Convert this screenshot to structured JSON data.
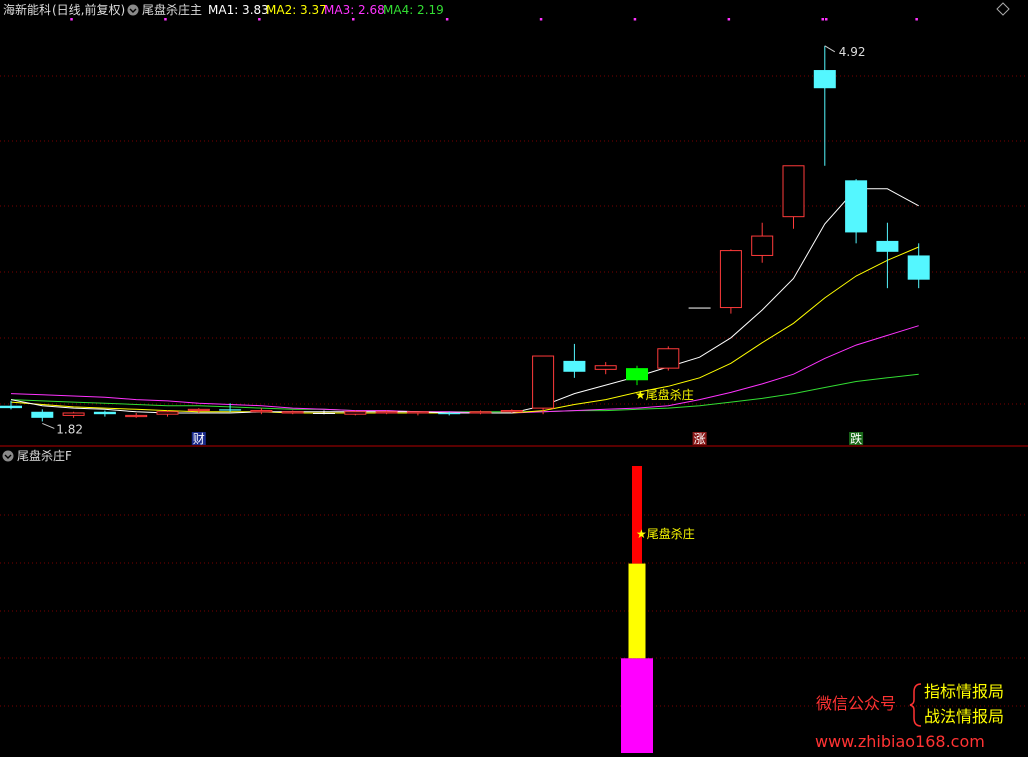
{
  "header": {
    "stock": "海新能科",
    "period": "(日线,前复权)",
    "indicator": "尾盘杀庄主",
    "ma_labels": [
      {
        "label": "MA1: 3.83",
        "color": "#ffffff"
      },
      {
        "label": "MA2: 3.37",
        "color": "#ffff00"
      },
      {
        "label": "MA3: 2.68",
        "color": "#ff33ff"
      },
      {
        "label": "MA4: 2.19",
        "color": "#33dd33"
      }
    ]
  },
  "sub_header": {
    "title": "尾盘杀庄F"
  },
  "annotations": {
    "high_label": "4.92",
    "low_label": "1.82",
    "signal_main": "★尾盘杀庄",
    "signal_sub": "★尾盘杀庄",
    "markers": [
      "财",
      "涨",
      "跌"
    ]
  },
  "watermark": {
    "wechat": "微信公众号",
    "line1": "指标情报局",
    "line2": "战法情报局",
    "url": "www.zhibiao168.com"
  },
  "colors": {
    "up": "#ff3b3b",
    "down": "#54f7ff",
    "flat": "#ffffff",
    "signal_candle": "#00ff00",
    "grid": "#7a0000",
    "divider": "#b40000",
    "ma1": "#ffffff",
    "ma2": "#ffff00",
    "ma3": "#ff33ff",
    "ma4": "#33dd33",
    "bar_red": "#ff0000",
    "bar_yellow": "#ffff00",
    "bar_magenta": "#ff00ff"
  },
  "chart_data": [
    {
      "type": "candlestick",
      "title": "尾盘杀庄主",
      "ylim": [
        1.7,
        5.1
      ],
      "candles": [
        {
          "o": 1.95,
          "h": 1.99,
          "l": 1.92,
          "c": 1.93
        },
        {
          "o": 1.9,
          "h": 1.92,
          "l": 1.82,
          "c": 1.85
        },
        {
          "o": 1.87,
          "h": 1.9,
          "l": 1.85,
          "c": 1.89
        },
        {
          "o": 1.9,
          "h": 1.91,
          "l": 1.86,
          "c": 1.88
        },
        {
          "o": 1.86,
          "h": 1.89,
          "l": 1.85,
          "c": 1.87
        },
        {
          "o": 1.88,
          "h": 1.91,
          "l": 1.86,
          "c": 1.9
        },
        {
          "o": 1.91,
          "h": 1.93,
          "l": 1.89,
          "c": 1.92
        },
        {
          "o": 1.92,
          "h": 1.97,
          "l": 1.9,
          "c": 1.91
        },
        {
          "o": 1.9,
          "h": 1.93,
          "l": 1.88,
          "c": 1.91
        },
        {
          "o": 1.89,
          "h": 1.91,
          "l": 1.88,
          "c": 1.9
        },
        {
          "o": 1.89,
          "h": 1.91,
          "l": 1.88,
          "c": 1.89
        },
        {
          "o": 1.88,
          "h": 1.91,
          "l": 1.87,
          "c": 1.9
        },
        {
          "o": 1.89,
          "h": 1.91,
          "l": 1.88,
          "c": 1.9
        },
        {
          "o": 1.89,
          "h": 1.9,
          "l": 1.87,
          "c": 1.9
        },
        {
          "o": 1.89,
          "h": 1.9,
          "l": 1.87,
          "c": 1.88
        },
        {
          "o": 1.89,
          "h": 1.91,
          "l": 1.88,
          "c": 1.9
        },
        {
          "o": 1.9,
          "h": 1.92,
          "l": 1.89,
          "c": 1.91
        },
        {
          "o": 1.93,
          "h": 1.95,
          "l": 1.88,
          "c": 2.36
        },
        {
          "o": 2.32,
          "h": 2.46,
          "l": 2.18,
          "c": 2.23
        },
        {
          "o": 2.25,
          "h": 2.31,
          "l": 2.21,
          "c": 2.28
        },
        {
          "o": 2.26,
          "h": 2.28,
          "l": 2.12,
          "c": 2.16
        },
        {
          "o": 2.26,
          "h": 2.44,
          "l": 2.24,
          "c": 2.42
        },
        {
          "o": 2.76,
          "h": 2.76,
          "l": 2.76,
          "c": 2.76
        },
        {
          "o": 2.76,
          "h": 3.24,
          "l": 2.71,
          "c": 3.23
        },
        {
          "o": 3.19,
          "h": 3.46,
          "l": 3.13,
          "c": 3.35
        },
        {
          "o": 3.51,
          "h": 3.93,
          "l": 3.41,
          "c": 3.93
        },
        {
          "o": 4.72,
          "h": 4.92,
          "l": 3.93,
          "c": 4.57
        },
        {
          "o": 3.81,
          "h": 3.82,
          "l": 3.29,
          "c": 3.38
        },
        {
          "o": 3.31,
          "h": 3.46,
          "l": 2.92,
          "c": 3.22
        },
        {
          "o": 3.19,
          "h": 3.29,
          "l": 2.92,
          "c": 2.99
        }
      ],
      "ma1": [
        2.0,
        1.95,
        1.93,
        1.92,
        1.9,
        1.89,
        1.89,
        1.89,
        1.9,
        1.9,
        1.9,
        1.9,
        1.9,
        1.9,
        1.89,
        1.89,
        1.89,
        1.95,
        2.05,
        2.12,
        2.19,
        2.27,
        2.35,
        2.51,
        2.74,
        3.0,
        3.45,
        3.74,
        3.74,
        3.6
      ],
      "ma2": [
        1.98,
        1.96,
        1.94,
        1.93,
        1.92,
        1.91,
        1.9,
        1.9,
        1.9,
        1.89,
        1.89,
        1.89,
        1.89,
        1.89,
        1.89,
        1.89,
        1.89,
        1.91,
        1.96,
        2.0,
        2.06,
        2.11,
        2.18,
        2.3,
        2.47,
        2.63,
        2.84,
        3.02,
        3.15,
        3.26
      ],
      "ma3": [
        2.05,
        2.04,
        2.03,
        2.02,
        2.0,
        1.99,
        1.97,
        1.96,
        1.95,
        1.93,
        1.92,
        1.91,
        1.91,
        1.9,
        1.9,
        1.89,
        1.89,
        1.9,
        1.91,
        1.92,
        1.93,
        1.95,
        2.0,
        2.06,
        2.13,
        2.21,
        2.34,
        2.45,
        2.53,
        2.61
      ],
      "ma4": [
        2.0,
        1.99,
        1.98,
        1.97,
        1.96,
        1.95,
        1.95,
        1.94,
        1.93,
        1.92,
        1.92,
        1.91,
        1.91,
        1.9,
        1.9,
        1.9,
        1.9,
        1.9,
        1.91,
        1.91,
        1.92,
        1.93,
        1.95,
        1.98,
        2.01,
        2.05,
        2.1,
        2.15,
        2.18,
        2.21
      ],
      "signal_index": 20,
      "high_index": 26,
      "low_index": 1,
      "marker_indices": [
        6,
        22,
        27
      ]
    },
    {
      "type": "stacked_bar",
      "title": "尾盘杀庄F",
      "index": 20,
      "ylim": [
        0,
        100
      ],
      "segments": [
        {
          "from": 0,
          "to": 33,
          "color": "#ff00ff"
        },
        {
          "from": 33,
          "to": 66,
          "color": "#ffff00"
        },
        {
          "from": 66,
          "to": 100,
          "color": "#ff0000"
        }
      ]
    }
  ]
}
